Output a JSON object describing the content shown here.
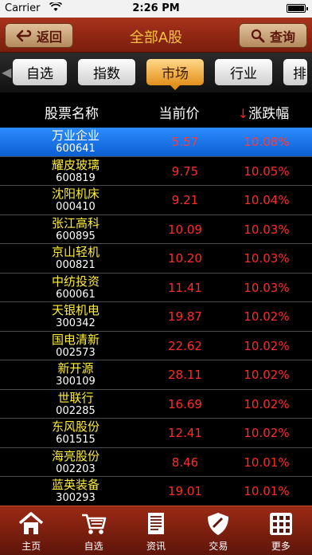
{
  "status": {
    "carrier": "Carrier",
    "time": "2:26 PM"
  },
  "navbar": {
    "back_label": "返回",
    "title": "全部A股",
    "search_label": "查询"
  },
  "tabs": [
    {
      "label": "自选"
    },
    {
      "label": "指数"
    },
    {
      "label": "市场",
      "active": true
    },
    {
      "label": "行业"
    },
    {
      "label": "排"
    }
  ],
  "columns": {
    "name": "股票名称",
    "price": "当前价",
    "change": "涨跌幅"
  },
  "rows": [
    {
      "name": "万业企业",
      "code": "600641",
      "price": "5.57",
      "change": "10.08%"
    },
    {
      "name": "耀皮玻璃",
      "code": "600819",
      "price": "9.75",
      "change": "10.05%"
    },
    {
      "name": "沈阳机床",
      "code": "000410",
      "price": "9.21",
      "change": "10.04%"
    },
    {
      "name": "张江高科",
      "code": "600895",
      "price": "10.09",
      "change": "10.03%"
    },
    {
      "name": "京山轻机",
      "code": "000821",
      "price": "10.20",
      "change": "10.03%"
    },
    {
      "name": "中纺投资",
      "code": "600061",
      "price": "11.41",
      "change": "10.03%"
    },
    {
      "name": "天银机电",
      "code": "300342",
      "price": "19.87",
      "change": "10.02%"
    },
    {
      "name": "国电清新",
      "code": "002573",
      "price": "22.62",
      "change": "10.02%"
    },
    {
      "name": "新开源",
      "code": "300109",
      "price": "28.11",
      "change": "10.02%"
    },
    {
      "name": "世联行",
      "code": "002285",
      "price": "16.69",
      "change": "10.02%"
    },
    {
      "name": "东风股份",
      "code": "601515",
      "price": "12.41",
      "change": "10.02%"
    },
    {
      "name": "海亮股份",
      "code": "002203",
      "price": "8.46",
      "change": "10.01%"
    },
    {
      "name": "蓝英装备",
      "code": "300293",
      "price": "19.01",
      "change": "10.01%"
    }
  ],
  "toolbar": [
    {
      "label": "主页",
      "icon": "home-icon"
    },
    {
      "label": "自选",
      "icon": "cart-icon"
    },
    {
      "label": "资讯",
      "icon": "newspaper-icon"
    },
    {
      "label": "交易",
      "icon": "shield-icon"
    },
    {
      "label": "更多",
      "icon": "grid-icon"
    }
  ],
  "colors": {
    "accent": "#f7c242",
    "up": "#ff2a2a",
    "selected": "#1a74e8"
  }
}
